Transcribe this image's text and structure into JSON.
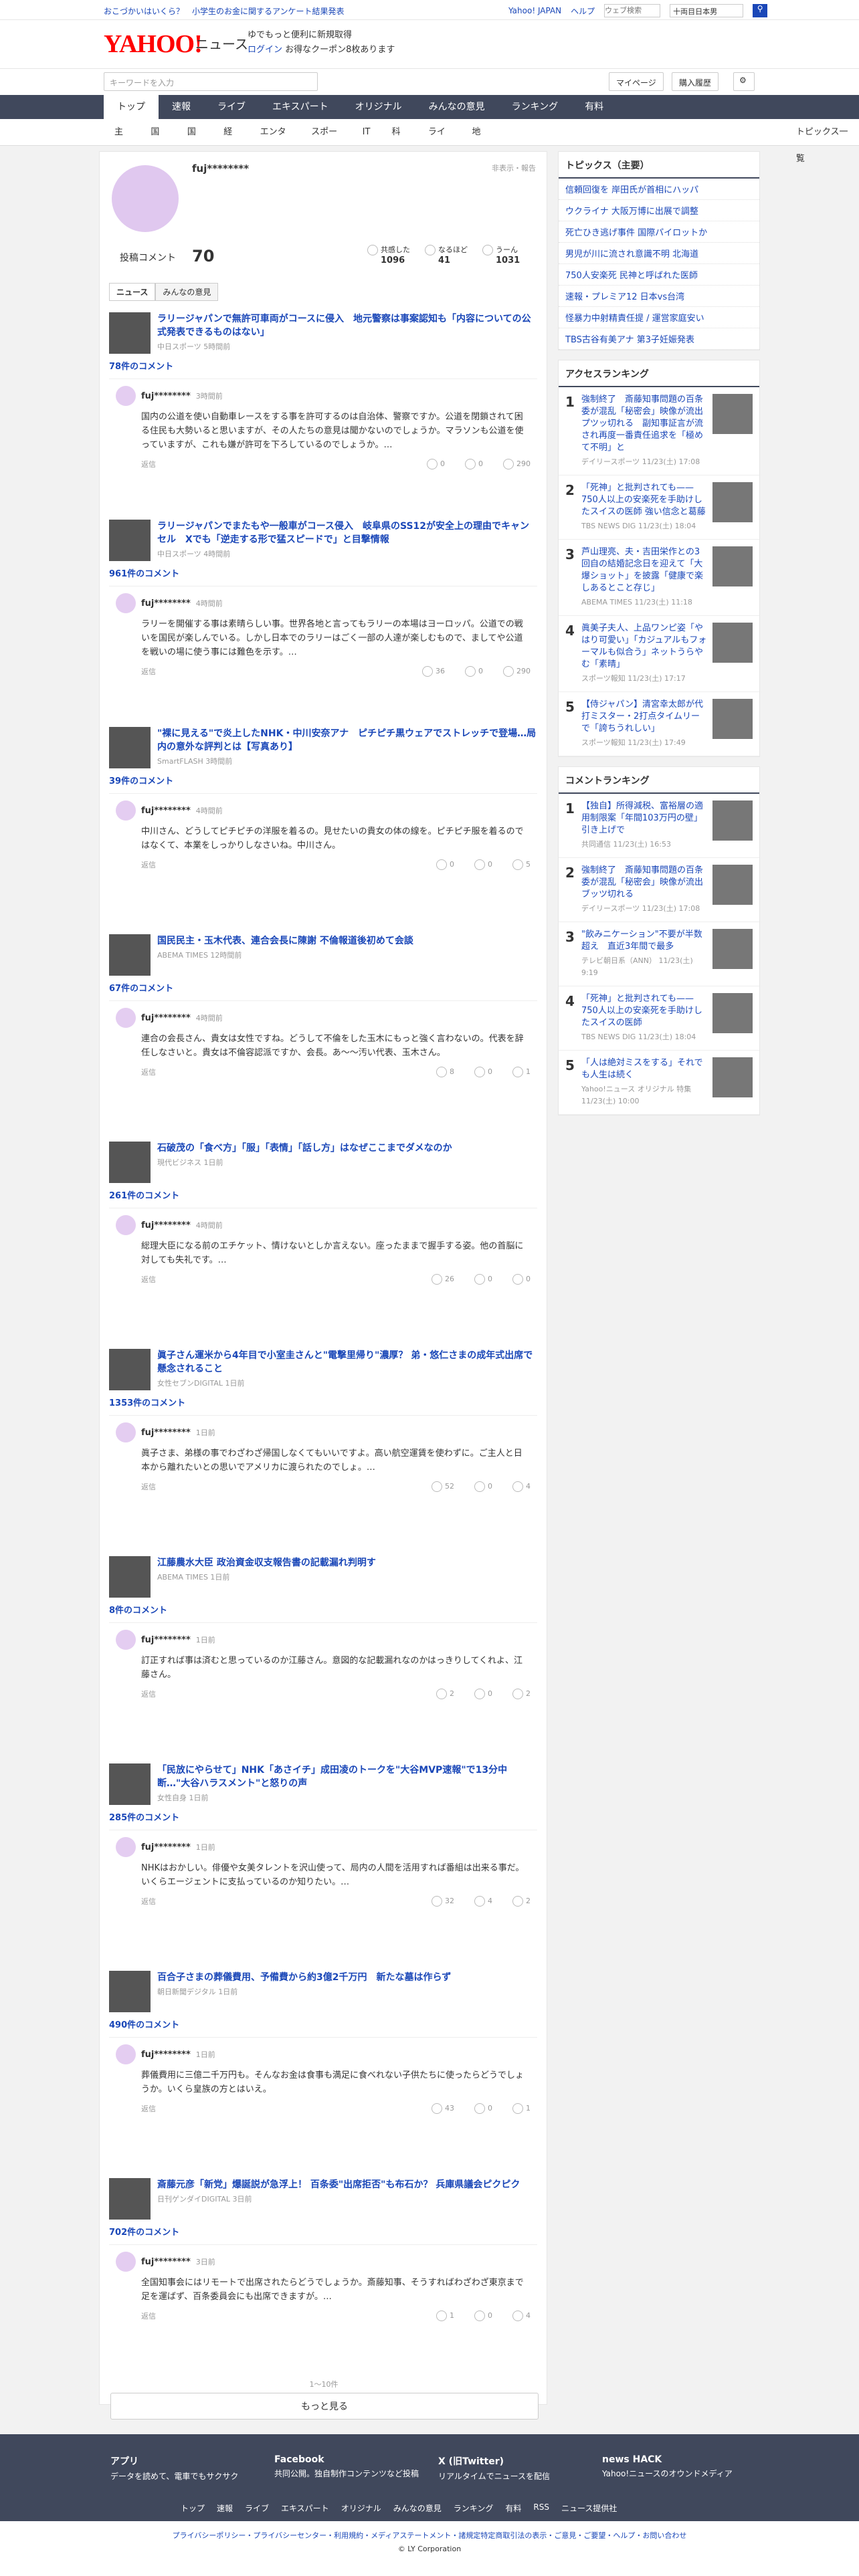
{
  "topstrip": {
    "left": "おこづかいはいくら？　小学生のお金に関するアンケート結果発表",
    "links": [
      "Yahoo! JAPAN",
      "ヘルプ"
    ],
    "search_placeholder": "ウェブ検索",
    "search_tag": "十両目日本男"
  },
  "header": {
    "logo": "YAHOO!",
    "logo_sub": "JAPAN",
    "site": "ニュース",
    "promo1": "ゆでもっと便利に新規取得",
    "promo2": "ログイン",
    "promo3": "お得なクーポン8枚あります"
  },
  "search": {
    "placeholder": "キーワードを入力",
    "mypage": "マイページ",
    "history": "購入履歴"
  },
  "nav": [
    "トップ",
    "速報",
    "ライブ",
    "エキスパート",
    "オリジナル",
    "みんなの意見",
    "ランキング",
    "有料"
  ],
  "categories": [
    "主要",
    "国内",
    "国際",
    "経済",
    "エンタメ",
    "スポーツ",
    "IT",
    "科学",
    "ライフ",
    "地域",
    "トピックス一覧"
  ],
  "profile": {
    "name": "fuj********",
    "hide": "非表示・報告",
    "post_label": "投稿コメント",
    "post_count": "70",
    "stats": [
      {
        "label": "共感した",
        "value": "1096"
      },
      {
        "label": "なるほど",
        "value": "41"
      },
      {
        "label": "うーん",
        "value": "1031"
      }
    ],
    "tabs": [
      "ニュース",
      "みんなの意見"
    ]
  },
  "entries": [
    {
      "title": "ラリージャパンで無許可車両がコースに侵入　地元警察は事案認知も「内容についての公式発表できるものはない」",
      "src": "中日スポーツ 5時間前",
      "cc": "78件のコメント",
      "user": "fuj********",
      "time": "3時間前",
      "text": "国内の公道を使い自動車レースをする事を許可するのは自治体、警察ですか。公道を閉鎖されて困る住民も大勢いると思いますが、その人たちの意見は聞かないのでしょうか。マラソンも公道を使っていますが、これも嫌が許可を下ろしているのでしょうか。…",
      "counts": [
        "0",
        "0",
        "290"
      ]
    },
    {
      "title": "ラリージャパンでまたもや一般車がコース侵入　岐阜県のSS12が安全上の理由でキャンセル　Xでも「逆走する形で猛スピードで」と目撃情報",
      "src": "中日スポーツ 4時間前",
      "cc": "961件のコメント",
      "user": "fuj********",
      "time": "4時間前",
      "text": "ラリーを開催する事は素晴らしい事。世界各地と言ってもラリーの本場はヨーロッパ。公道での戦いを国民が楽しんでいる。しかし日本でのラリーはごく一部の人達が楽しむもので、ましてや公道を戦いの場に使う事には難色を示す。…",
      "counts": [
        "36",
        "0",
        "290"
      ]
    },
    {
      "title": "\"裸に見える\"で炎上したNHK・中川安奈アナ　ピチピチ黒ウェアでストレッチで登場…局内の意外な評判とは【写真あり】",
      "src": "SmartFLASH 3時間前",
      "cc": "39件のコメント",
      "user": "fuj********",
      "time": "4時間前",
      "text": "中川さん、どうしてピチピチの洋服を着るの。見せたいの貴女の体の線を。ピチピチ服を着るのではなくて、本業をしっかりしなさいね。中川さん。",
      "counts": [
        "0",
        "0",
        "5"
      ]
    },
    {
      "title": "国民民主・玉木代表、連合会長に陳謝 不倫報道後初めて会談",
      "src": "ABEMA TIMES 12時間前",
      "cc": "67件のコメント",
      "user": "fuj********",
      "time": "4時間前",
      "text": "連合の会長さん、貴女は女性ですね。どうして不倫をした玉木にもっと強く言わないの。代表を辞任しなさいと。貴女は不倫容認派ですか、会長。あ～～汚い代表、玉木さん。",
      "counts": [
        "8",
        "0",
        "1"
      ]
    },
    {
      "title": "石破茂の「食べ方」「服」「表情」「話し方」はなぜここまでダメなのか",
      "src": "現代ビジネス 1日前",
      "cc": "261件のコメント",
      "user": "fuj********",
      "time": "4時間前",
      "text": "総理大臣になる前のエチケット、情けないとしか言えない。座ったままで握手する姿。他の首脳に対しても失礼です。…",
      "counts": [
        "26",
        "0",
        "0"
      ]
    },
    {
      "title": "眞子さん運米から4年目で小室圭さんと\"電撃里帰り\"濃厚？ 弟・悠仁さまの成年式出席で懸念されること",
      "src": "女性セブンDIGITAL 1日前",
      "cc": "1353件のコメント",
      "user": "fuj********",
      "time": "1日前",
      "text": "眞子さま、弟様の事でわざわざ帰国しなくてもいいですよ。高い航空運賃を使わずに。ご主人と日本から離れたいとの思いでアメリカに渡られたのでしょ。…",
      "counts": [
        "52",
        "0",
        "4"
      ]
    },
    {
      "title": "江藤農水大臣 政治資金収支報告書の記載漏れ判明す",
      "src": "ABEMA TIMES 1日前",
      "cc": "8件のコメント",
      "user": "fuj********",
      "time": "1日前",
      "text": "訂正すれば事は済むと思っているのか江藤さん。意図的な記載漏れなのかはっきりしてくれよ、江藤さん。",
      "counts": [
        "2",
        "0",
        "2"
      ]
    },
    {
      "title": "「民放にやらせて」NHK「あさイチ」成田凌のトークを\"大谷MVP速報\"で13分中断…\"大谷ハラスメント\"と怒りの声",
      "src": "女性自身 1日前",
      "cc": "285件のコメント",
      "user": "fuj********",
      "time": "1日前",
      "text": "NHKはおかしい。俳優や女美タレントを沢山使って、局内の人間を活用すれば番組は出来る事だ。いくらエージェントに支払っているのか知りたい。…",
      "counts": [
        "32",
        "4",
        "2"
      ]
    },
    {
      "title": "百合子さまの葬儀費用、予備費から約3億2千万円　新たな墓は作らず",
      "src": "朝日新聞デジタル 1日前",
      "cc": "490件のコメント",
      "user": "fuj********",
      "time": "1日前",
      "text": "葬儀費用に三億二千万円も。そんなお金は食事も満足に食べれない子供たちに使ったらどうでしょうか。いくら皇族の方とはいえ。",
      "counts": [
        "43",
        "0",
        "1"
      ]
    },
    {
      "title": "斎藤元彦「新党」爆誕説が急浮上！ 百条委\"出席拒否\"も布石か？ 兵庫県議会ピクピク",
      "src": "日刊ゲンダイDIGITAL 3日前",
      "cc": "702件のコメント",
      "user": "fuj********",
      "time": "3日前",
      "text": "全国知事会にはリモートで出席されたらどうでしょうか。斎藤知事、そうすればわざわざ東京まで足を運ばず、百条委員会にも出席できますが。…",
      "counts": [
        "1",
        "0",
        "4"
      ]
    }
  ],
  "paging": "1〜10件",
  "more": "もっと見る",
  "sidebar": {
    "topics_title": "トピックス（主要）",
    "topics": [
      "信頼回復を 岸田氏が首相にハッパ",
      "ウクライナ 大阪万博に出展で調整",
      "死亡ひき逃げ事件 国際パイロットか",
      "男児が川に流され意識不明 北海道",
      "750人安楽死 民神と呼ばれた医師",
      "速報・プレミア12 日本vs台湾",
      "怪暴力中射精責任提 / 運営家庭安い",
      "TBS古谷有美アナ 第3子妊娠発表"
    ],
    "access_title": "アクセスランキング",
    "access": [
      {
        "t": "強制終了　斎藤知事問題の百条委が混乱「秘密会」映像が流出プツッ切れる　副知事証言が流され再度一番責任追求を「極めて不明」と",
        "s": "デイリースポーツ 11/23(土) 17:08"
      },
      {
        "t": "「死神」と批判されても——750人以上の安楽死を手助けしたスイスの医師 強い信念と葛藤",
        "s": "TBS NEWS DIG 11/23(土) 18:04"
      },
      {
        "t": "芦山理亮、夫・吉田栄作との3回自の結婚記念日を迎えて「大爆ショット」を披露「健康で楽しあるとこと存じ」",
        "s": "ABEMA TIMES 11/23(土) 11:18"
      },
      {
        "t": "眞美子夫人、上品ワンピ姿「やはり可愛い」「カジュアルもフォーマルも似合う」ネットうらやむ「素晴」",
        "s": "スポーツ報知 11/23(土) 17:17"
      },
      {
        "t": "【侍ジャパン】清宮幸太郎が代打ミスター・2打点タイムリーで「誇ちうれしい」",
        "s": "スポーツ報知 11/23(土) 17:49"
      }
    ],
    "comment_title": "コメントランキング",
    "comment": [
      {
        "t": "【独自】所得減税、富裕層の適用制限案「年間103万円の壁」引き上げで",
        "s": "共同通信 11/23(土) 16:53"
      },
      {
        "t": "強制終了　斎藤知事問題の百条委が混乱「秘密会」映像が流出ブッツ切れる",
        "s": "デイリースポーツ 11/23(土) 17:08"
      },
      {
        "t": "\"飲みニケーション\"不要が半数超え　直近3年間で最多",
        "s": "テレビ朝日系（ANN） 11/23(土) 9:19"
      },
      {
        "t": "「死神」と批判されても——750人以上の安楽死を手助けしたスイスの医師",
        "s": "TBS NEWS DIG 11/23(土) 18:04"
      },
      {
        "t": "「人は絶対ミスをする」それでも人生は続く",
        "s": "Yahoo!ニュース オリジナル 特集 11/23(土) 10:00"
      }
    ]
  },
  "footer": {
    "cols": [
      {
        "h": "アプリ",
        "d": "データを読めて、電車でもサクサク"
      },
      {
        "h": "Facebook",
        "d": "共同公開。独自制作コンテンツなど投稿"
      },
      {
        "h": "X (旧Twitter)",
        "d": "リアルタイムでニュースを配信"
      },
      {
        "h": "news HACK",
        "d": "Yahoo!ニュースのオウンドメディア"
      }
    ],
    "nav": [
      "トップ",
      "速報",
      "ライブ",
      "エキスパート",
      "オリジナル",
      "みんなの意見",
      "ランキング",
      "有料",
      "RSS",
      "ニュース提供社"
    ],
    "legal": "プライバシーポリシー・プライバシーセンター・利用規約・メディアステートメント・諸規定特定商取引法の表示・ご意見・ご要望・ヘルプ・お問い合わせ",
    "copy": "© LY Corporation"
  }
}
